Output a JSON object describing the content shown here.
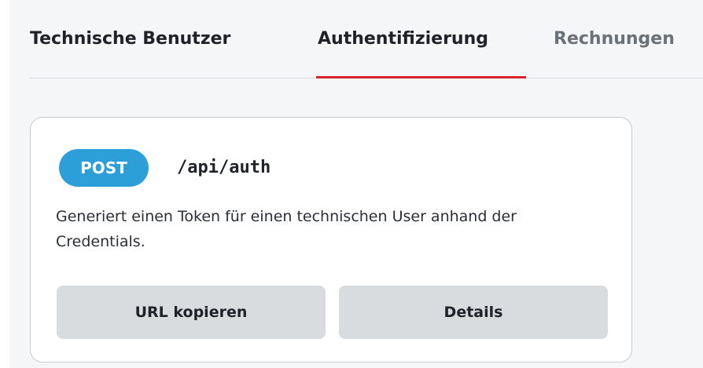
{
  "tabs": [
    {
      "label": "Technische Benutzer",
      "active": false
    },
    {
      "label": "Authentifizierung",
      "active": true
    },
    {
      "label": "Rechnungen",
      "active": false
    }
  ],
  "colors": {
    "active_tab_underline": "#d8232a",
    "method_badge": "#2c9fd8",
    "button_bg": "#d8dcdf",
    "page_bg": "#f4f6f8"
  },
  "endpoint": {
    "method": "POST",
    "path": "/api/auth",
    "description": "Generiert einen Token für einen technischen User anhand der Credentials.",
    "copy_button_label": "URL kopieren",
    "details_button_label": "Details"
  }
}
